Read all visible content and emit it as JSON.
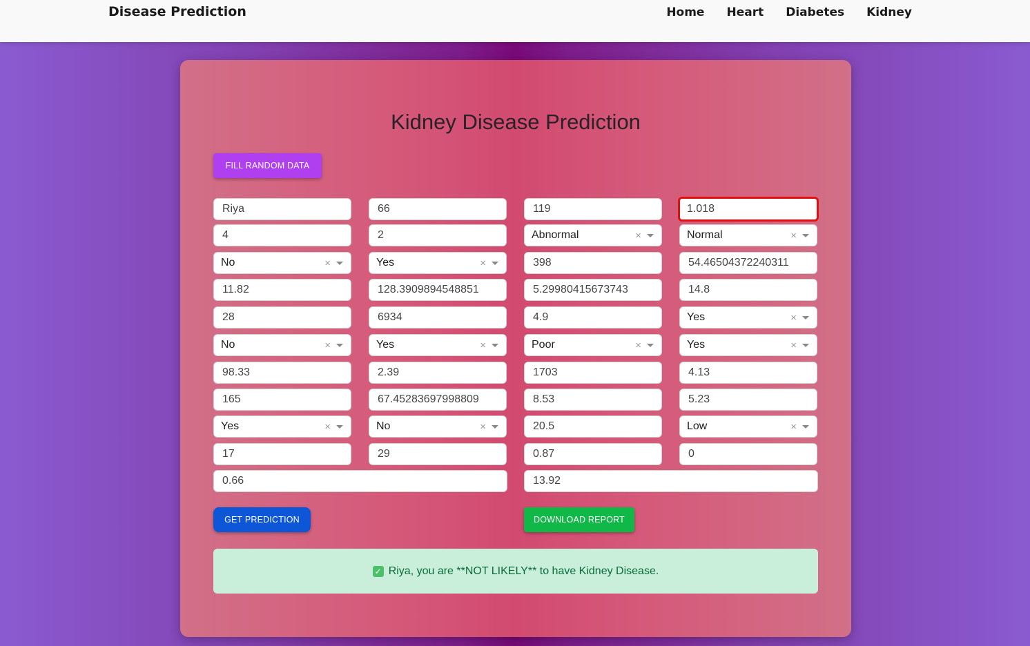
{
  "navbar": {
    "brand": "Disease Prediction",
    "links": [
      "Home",
      "Heart",
      "Diabetes",
      "Kidney"
    ]
  },
  "form": {
    "title": "Kidney Disease Prediction",
    "fill_random_label": "FILL RANDOM DATA",
    "fields": [
      {
        "value": "Riya",
        "type": "text"
      },
      {
        "value": "66",
        "type": "text"
      },
      {
        "value": "119",
        "type": "text"
      },
      {
        "value": "1.018",
        "type": "text",
        "focused": true
      },
      {
        "value": "4",
        "type": "text"
      },
      {
        "value": "2",
        "type": "text"
      },
      {
        "value": "Abnormal",
        "type": "select"
      },
      {
        "value": "Normal",
        "type": "select"
      },
      {
        "value": "No",
        "type": "select"
      },
      {
        "value": "Yes",
        "type": "select"
      },
      {
        "value": "398",
        "type": "text"
      },
      {
        "value": "54.46504372240311",
        "type": "text"
      },
      {
        "value": "11.82",
        "type": "text"
      },
      {
        "value": "128.3909894548851",
        "type": "text"
      },
      {
        "value": "5.29980415673743",
        "type": "text"
      },
      {
        "value": "14.8",
        "type": "text"
      },
      {
        "value": "28",
        "type": "text"
      },
      {
        "value": "6934",
        "type": "text"
      },
      {
        "value": "4.9",
        "type": "text"
      },
      {
        "value": "Yes",
        "type": "select"
      },
      {
        "value": "No",
        "type": "select"
      },
      {
        "value": "Yes",
        "type": "select"
      },
      {
        "value": "Poor",
        "type": "select"
      },
      {
        "value": "Yes",
        "type": "select"
      },
      {
        "value": "98.33",
        "type": "text"
      },
      {
        "value": "2.39",
        "type": "text"
      },
      {
        "value": "1703",
        "type": "text"
      },
      {
        "value": "4.13",
        "type": "text"
      },
      {
        "value": "165",
        "type": "text"
      },
      {
        "value": "67.45283697998809",
        "type": "text"
      },
      {
        "value": "8.53",
        "type": "text"
      },
      {
        "value": "5.23",
        "type": "text"
      },
      {
        "value": "Yes",
        "type": "select"
      },
      {
        "value": "No",
        "type": "select"
      },
      {
        "value": "20.5",
        "type": "text"
      },
      {
        "value": "Low",
        "type": "select"
      },
      {
        "value": "17",
        "type": "text"
      },
      {
        "value": "29",
        "type": "text"
      },
      {
        "value": "0.87",
        "type": "text"
      },
      {
        "value": "0",
        "type": "text"
      },
      {
        "value": "0.66",
        "type": "text"
      },
      {
        "value": "13.92",
        "type": "text"
      }
    ],
    "predict_label": "GET PREDICTION",
    "download_label": "DOWNLOAD REPORT",
    "clear_glyph": "×",
    "result": {
      "check_glyph": "✓",
      "text": "Riya, you are **NOT LIKELY** to have Kidney Disease."
    }
  },
  "colors": {
    "fill_button": "#b03ff0",
    "predict_button": "#0e56d8",
    "download_button": "#10b848",
    "result_bg": "#c9efdb",
    "result_text": "#0a6b3a",
    "focus_border": "#e01010"
  }
}
